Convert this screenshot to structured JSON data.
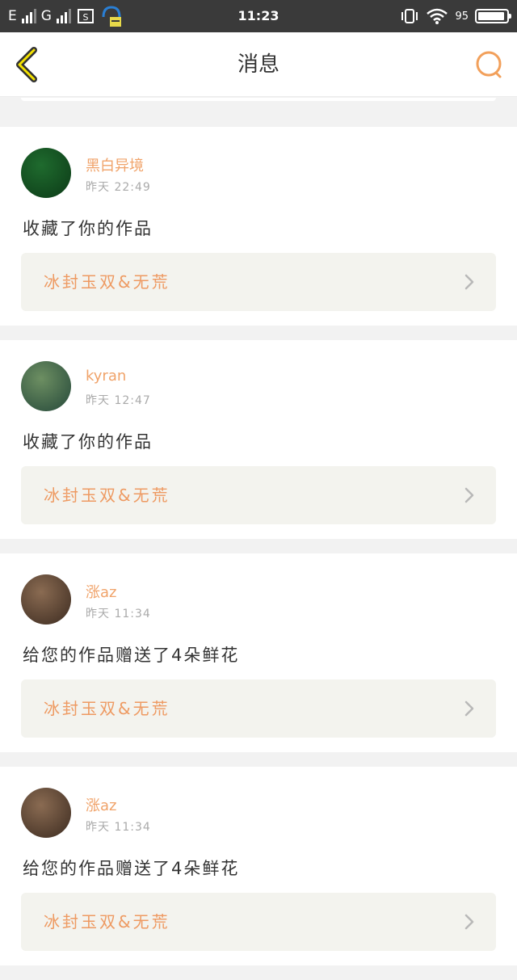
{
  "status_bar": {
    "carrier1": "E",
    "carrier2": "G",
    "time": "11:23",
    "battery_text": "95",
    "battery_level": 0.95
  },
  "header": {
    "title": "消息"
  },
  "notifications": [
    {
      "username": "黑白异境",
      "time": "昨天 22:49",
      "action": "收藏了你的作品",
      "work_title": "冰封玉双&无荒",
      "avatar_colors": [
        "#1f6b2e",
        "#0c3a17"
      ]
    },
    {
      "username": "kyran",
      "time": "昨天 12:47",
      "action": "收藏了你的作品",
      "work_title": "冰封玉双&无荒",
      "avatar_colors": [
        "#6d8f62",
        "#25483a"
      ]
    },
    {
      "username": "涨az",
      "time": "昨天 11:34",
      "action": "给您的作品赠送了4朵鲜花",
      "work_title": "冰封玉双&无荒",
      "avatar_colors": [
        "#8a6b52",
        "#3c2b20"
      ]
    },
    {
      "username": "涨az",
      "time": "昨天 11:34",
      "action": "给您的作品赠送了4朵鲜花",
      "work_title": "冰封玉双&无荒",
      "avatar_colors": [
        "#8a6b52",
        "#3c2b20"
      ]
    }
  ],
  "colors": {
    "accent": "#f0a36a",
    "work_title": "#ee9a62",
    "icon": "#f2a05b"
  },
  "icons": {
    "back": "chevron-left-icon",
    "search": "search-icon",
    "work": "chevron-right-icon"
  }
}
